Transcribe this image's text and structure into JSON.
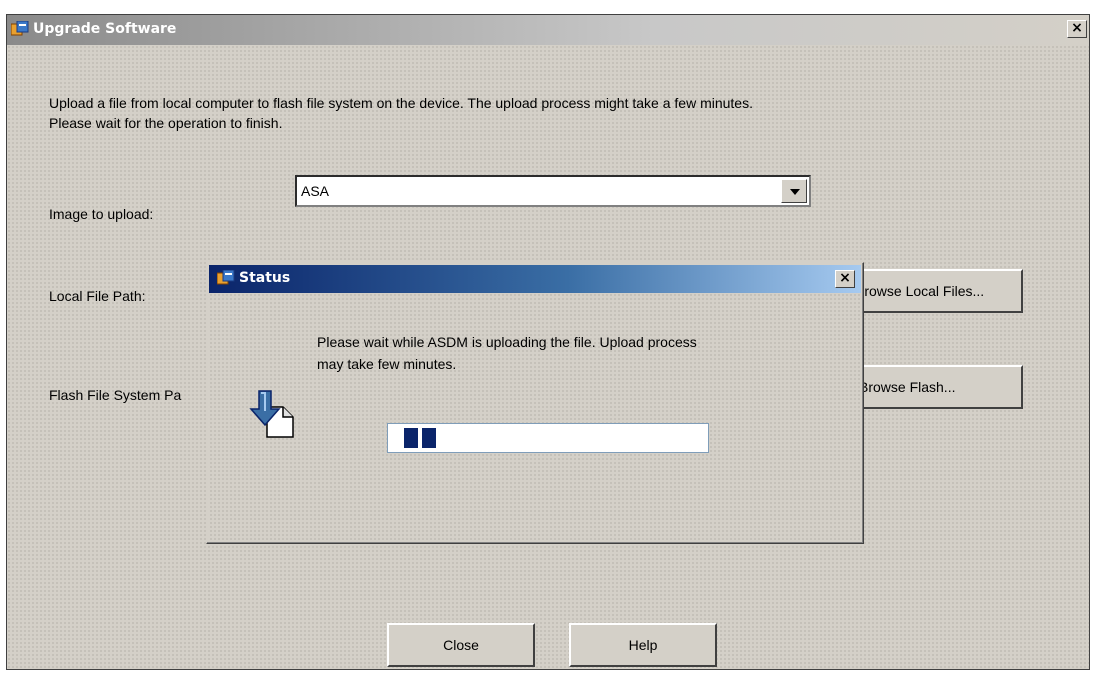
{
  "window": {
    "title": "Upgrade Software",
    "close_glyph": "×",
    "description_line1": "Upload a file from local computer to flash file system on the device. The upload process might take a few minutes.",
    "description_line2": "Please wait for the operation to finish.",
    "image_label": "Image to upload:",
    "image_value": "ASA",
    "local_path_label": "Local File Path:",
    "flash_path_label": "Flash File System Pa",
    "browse_local_label": "Browse Local Files...",
    "browse_flash_label": "Browse Flash...",
    "close_button": "Close",
    "help_button": "Help"
  },
  "status_dialog": {
    "title": "Status",
    "close_glyph": "×",
    "message_line1": "Please wait while ASDM is uploading the file. Upload process",
    "message_line2": "may take few minutes.",
    "progress_indeterminate_blocks": 2
  },
  "icons": {
    "window_icon": "cisco-app-icon",
    "dialog_icon": "cisco-app-icon",
    "upload_icon": "file-download-arrow-icon"
  },
  "colors": {
    "dialog_titlebar": "#0a246a",
    "progress_block": "#0a246a"
  }
}
